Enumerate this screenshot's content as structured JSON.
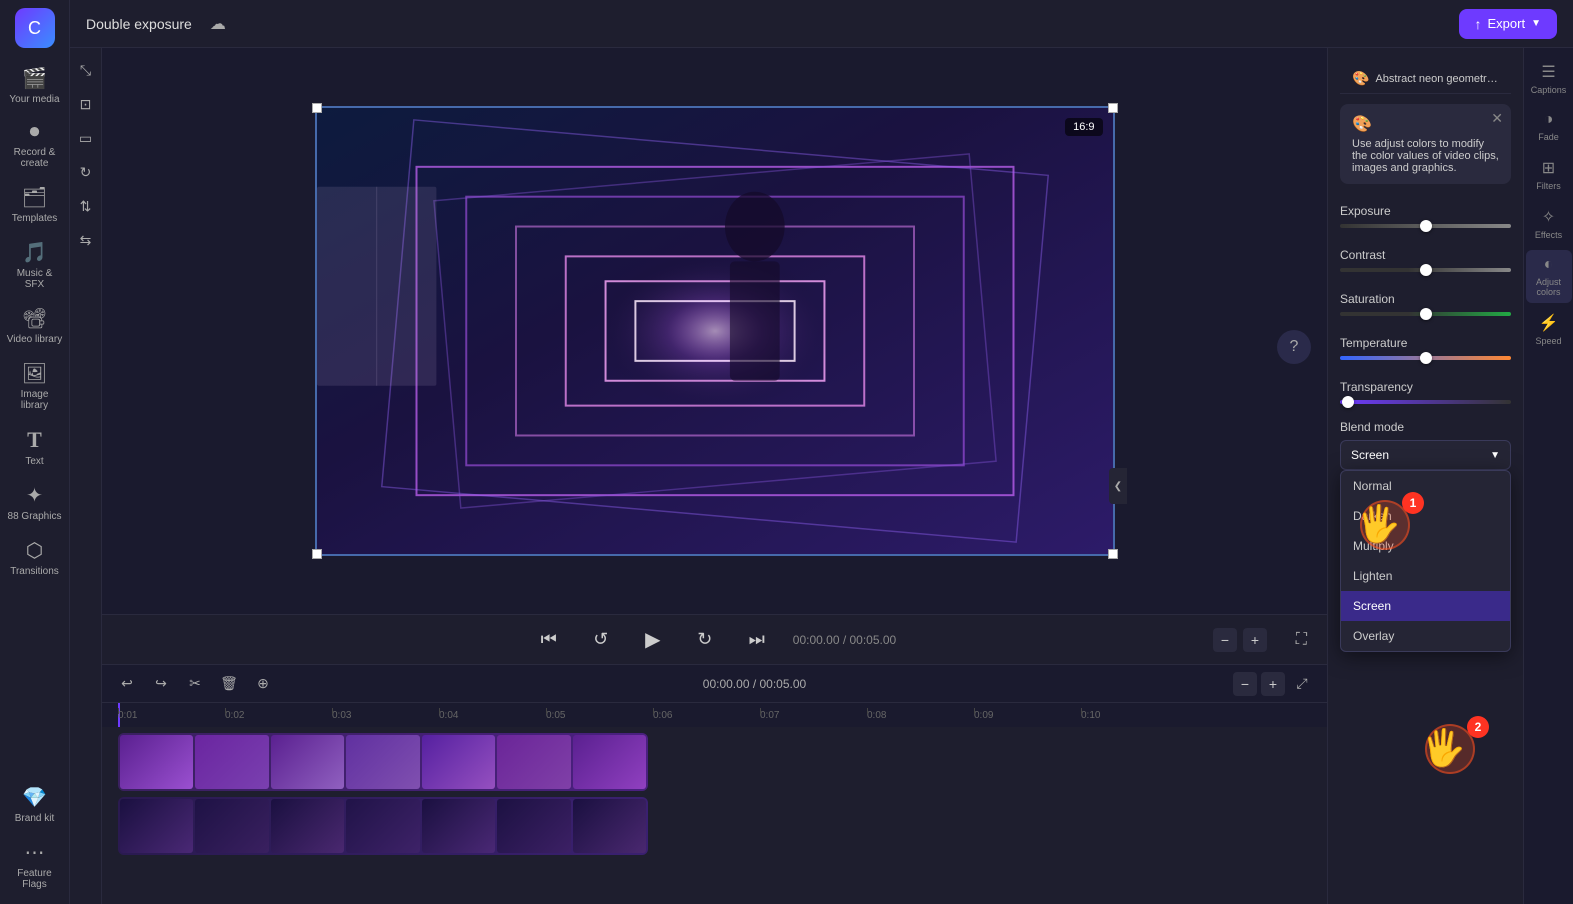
{
  "app": {
    "title": "Double exposure",
    "logo_bg": "gradient"
  },
  "topbar": {
    "title": "Double exposure",
    "export_label": "Export",
    "cloud_icon": "☁"
  },
  "sidebar": {
    "items": [
      {
        "id": "your-media",
        "label": "Your media",
        "icon": "🎬"
      },
      {
        "id": "record-create",
        "label": "Record & create",
        "icon": "⏺"
      },
      {
        "id": "templates",
        "label": "Templates",
        "icon": "🗂"
      },
      {
        "id": "music-sfx",
        "label": "Music & SFX",
        "icon": "🎵"
      },
      {
        "id": "video-library",
        "label": "Video library",
        "icon": "📽"
      },
      {
        "id": "image-library",
        "label": "Image library",
        "icon": "🖼"
      },
      {
        "id": "text",
        "label": "Text",
        "icon": "T"
      },
      {
        "id": "graphics",
        "label": "88 Graphics",
        "icon": "✦"
      },
      {
        "id": "transitions",
        "label": "Transitions",
        "icon": "⬡"
      },
      {
        "id": "brand-kit",
        "label": "Brand kit",
        "icon": "💎"
      },
      {
        "id": "feature-flags",
        "label": "Feature Flags",
        "icon": "⋯"
      }
    ]
  },
  "canvas_toolbar": {
    "tools": [
      {
        "id": "fit",
        "icon": "⤡"
      },
      {
        "id": "crop",
        "icon": "⊡"
      },
      {
        "id": "aspect",
        "icon": "▭"
      },
      {
        "id": "rotate",
        "icon": "↻"
      },
      {
        "id": "flip-v",
        "icon": "⇅"
      },
      {
        "id": "flip-h",
        "icon": "⇆"
      }
    ]
  },
  "video_preview": {
    "aspect_ratio": "16:9"
  },
  "video_controls": {
    "skip_back_icon": "⏮",
    "rewind_icon": "↺",
    "play_icon": "▶",
    "forward_icon": "↻",
    "skip_forward_icon": "⏭",
    "timecode": "00:00.00 / 00:05.00",
    "fullscreen_icon": "⛶"
  },
  "timeline": {
    "undo_icon": "↩",
    "redo_icon": "↪",
    "cut_icon": "✂",
    "delete_icon": "🗑",
    "add_icon": "⊕",
    "timecode": "00:00.00 / 00:05.00",
    "zoom_in_icon": "+",
    "zoom_out_icon": "-",
    "expand_icon": "⤢",
    "ruler_marks": [
      "0:01",
      "0:02",
      "0:03",
      "0:04",
      "0:05",
      "0:06",
      "0:07",
      "0:08",
      "0:09",
      "0:10"
    ]
  },
  "panel": {
    "header_title": "Abstract neon geometric seaml...",
    "info_text": "Use adjust colors to modify the color values of video clips, images and graphics.",
    "info_emoji": "🎨",
    "exposure_label": "Exposure",
    "exposure_value": 0,
    "contrast_label": "Contrast",
    "contrast_value": 0,
    "saturation_label": "Saturation",
    "saturation_value": 0,
    "temperature_label": "Temperature",
    "temperature_value": 0,
    "transparency_label": "Transparency",
    "transparency_value": 0,
    "blend_mode_label": "Blend mode",
    "blend_selected": "Screen",
    "blend_options": [
      "Normal",
      "Darken",
      "Multiply",
      "Lighten",
      "Screen",
      "Overlay"
    ]
  },
  "far_right": {
    "items": [
      {
        "id": "captions",
        "label": "Captions",
        "icon": "☰"
      },
      {
        "id": "fade",
        "label": "Fade",
        "icon": "◑"
      },
      {
        "id": "filters",
        "label": "Filters",
        "icon": "⊞"
      },
      {
        "id": "effects",
        "label": "Effects",
        "icon": "✧"
      },
      {
        "id": "adjust",
        "label": "Adjust colors",
        "icon": "◐"
      },
      {
        "id": "speed",
        "label": "Speed",
        "icon": "⚡"
      }
    ]
  },
  "cursor": {
    "badge1": "1",
    "badge2": "2"
  }
}
